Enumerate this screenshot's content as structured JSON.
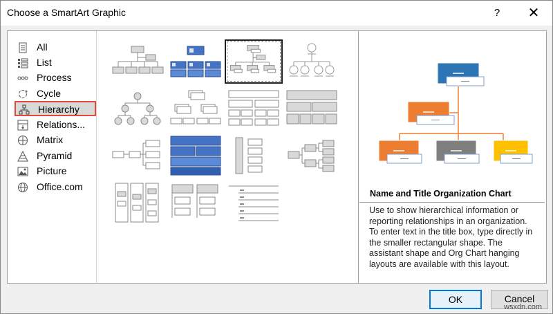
{
  "dialog": {
    "title": "Choose a SmartArt Graphic",
    "help_label": "?",
    "close_label": "✕"
  },
  "categories": [
    {
      "label": "All",
      "icon": "all-icon"
    },
    {
      "label": "List",
      "icon": "list-icon"
    },
    {
      "label": "Process",
      "icon": "process-icon"
    },
    {
      "label": "Cycle",
      "icon": "cycle-icon"
    },
    {
      "label": "Hierarchy",
      "icon": "hierarchy-icon",
      "selected": true
    },
    {
      "label": "Relations...",
      "icon": "relationship-icon"
    },
    {
      "label": "Matrix",
      "icon": "matrix-icon"
    },
    {
      "label": "Pyramid",
      "icon": "pyramid-icon"
    },
    {
      "label": "Picture",
      "icon": "picture-icon"
    },
    {
      "label": "Office.com",
      "icon": "globe-icon"
    }
  ],
  "gallery": {
    "selected_index": 2,
    "layouts": [
      "org-chart",
      "picture-org-chart",
      "name-title-org-chart",
      "circle-picture-hierarchy",
      "hierarchy",
      "labeled-hierarchy",
      "table-hierarchy",
      "architecture-layout",
      "horizontal-hierarchy",
      "horizontal-multi-level",
      "half-circle-org",
      "horizontal-labeled",
      "vertical-hierarchy",
      "lined-list",
      "stacked-list",
      "hierarchy-list"
    ]
  },
  "preview": {
    "title": "Name and Title Organization Chart",
    "description": "Use to show hierarchical information or reporting relationships in an organization. To enter text in the title box, type directly in the smaller rectangular shape. The assistant shape and Org Chart hanging layouts are available with this layout.",
    "colors": {
      "top": "#2e75b6",
      "orange": "#ed7d31",
      "gray": "#7f7f7f",
      "gold": "#ffc000"
    }
  },
  "buttons": {
    "ok": "OK",
    "cancel": "Cancel"
  },
  "watermark": "wsxdn.com"
}
